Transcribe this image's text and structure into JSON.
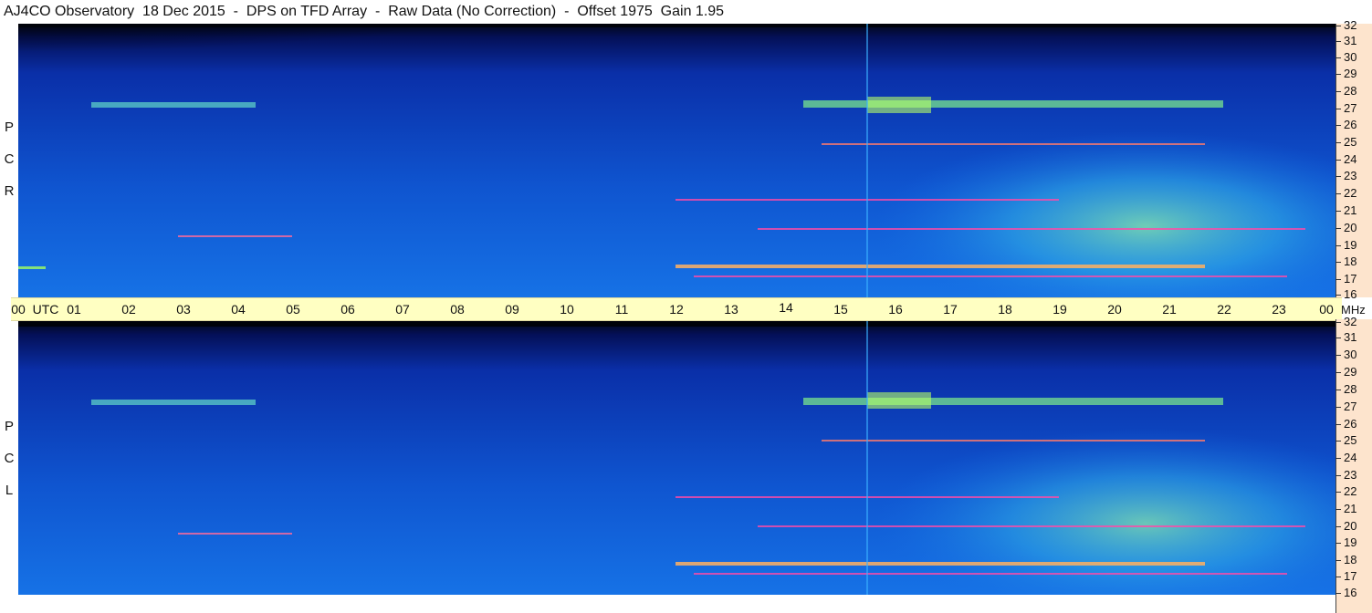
{
  "header": {
    "title": "AJ4CO Observatory  18 Dec 2015  -  DPS on TFD Array  -  Raw Data (No Correction)  -  Offset 1975  Gain 1.95"
  },
  "panels": {
    "top": {
      "letters": [
        "R",
        "C",
        "P"
      ]
    },
    "bottom": {
      "letters": [
        "L",
        "C",
        "P"
      ]
    }
  },
  "time_axis": {
    "ticks": [
      "00",
      "UTC",
      "01",
      "02",
      "03",
      "04",
      "05",
      "06",
      "07",
      "08",
      "09",
      "10",
      "11",
      "12",
      "13",
      "14",
      "15",
      "16",
      "17",
      "18",
      "19",
      "20",
      "21",
      "22",
      "23",
      "00"
    ],
    "unit": "MHz"
  },
  "freq_axis": {
    "ticks": [
      "32",
      "31",
      "30",
      "29",
      "28",
      "27",
      "26",
      "25",
      "24",
      "23",
      "22",
      "21",
      "20",
      "19",
      "18",
      "17",
      "16"
    ]
  },
  "colors": {
    "background": "#0a2c9a",
    "strip": "#ffffc2",
    "axis": "#fde4cd"
  }
}
